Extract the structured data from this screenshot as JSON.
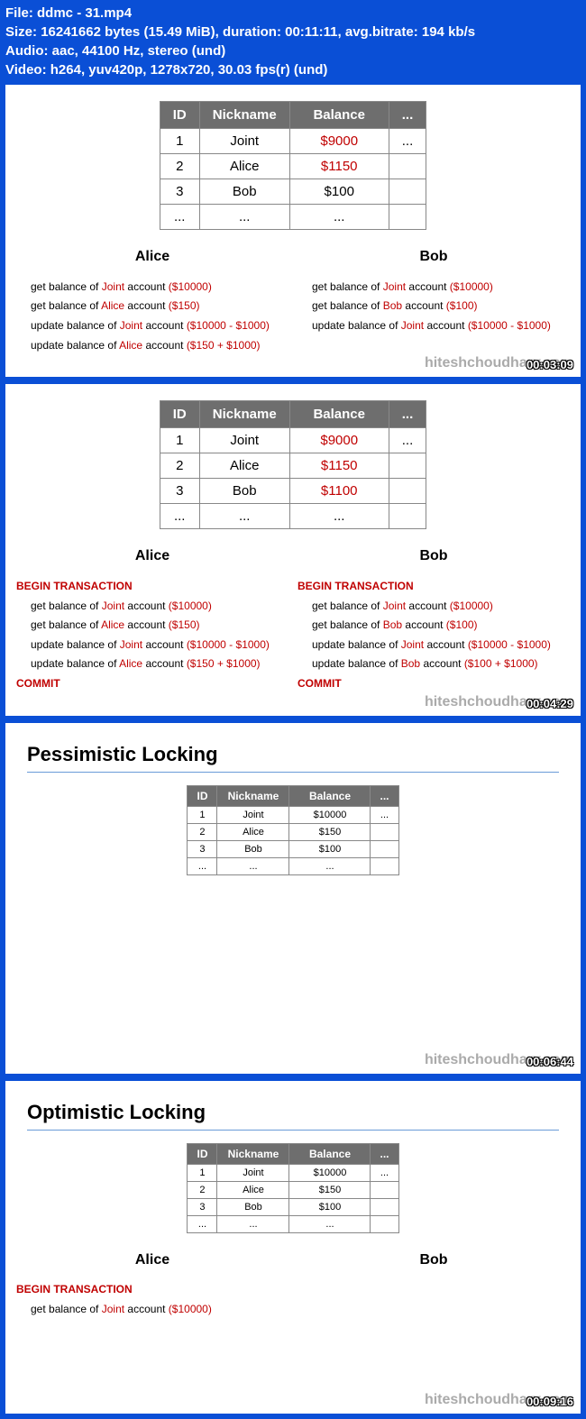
{
  "header": {
    "file_label": "File:",
    "file_value": "ddmc - 31.mp4",
    "size_label": "Size:",
    "size_value": "16241662 bytes (15.49 MiB), duration: 00:11:11, avg.bitrate: 194 kb/s",
    "audio_label": "Audio:",
    "audio_value": "aac, 44100 Hz, stereo (und)",
    "video_label": "Video:",
    "video_value": "h264, yuv420p, 1278x720, 30.03 fps(r) (und)"
  },
  "watermark": "hiteshchoudhary.com",
  "frames": {
    "f1": {
      "timestamp": "00:03:09",
      "table": {
        "headers": [
          "ID",
          "Nickname",
          "Balance",
          "..."
        ],
        "rows": [
          {
            "id": "1",
            "nick": "Joint",
            "bal": "$9000",
            "bal_red": true,
            "dots": "..."
          },
          {
            "id": "2",
            "nick": "Alice",
            "bal": "$1150",
            "bal_red": true,
            "dots": ""
          },
          {
            "id": "3",
            "nick": "Bob",
            "bal": "$100",
            "bal_red": false,
            "dots": ""
          },
          {
            "id": "...",
            "nick": "...",
            "bal": "...",
            "bal_red": false,
            "dots": ""
          }
        ]
      },
      "alice_title": "Alice",
      "bob_title": "Bob",
      "alice_lines": [
        {
          "pre": "get balance of ",
          "red": "Joint",
          "mid": " account ",
          "paren": "($10000)"
        },
        {
          "pre": "get balance of ",
          "red": "Alice",
          "mid": " account ",
          "paren": "($150)"
        },
        {
          "pre": "update balance of ",
          "red": "Joint",
          "mid": " account ",
          "paren": "($10000 - $1000)"
        },
        {
          "pre": "update balance of ",
          "red": "Alice",
          "mid": " account ",
          "paren": "($150 + $1000)"
        }
      ],
      "bob_lines": [
        {
          "pre": "get balance of ",
          "red": "Joint",
          "mid": " account ",
          "paren": "($10000)"
        },
        {
          "pre": "get balance of ",
          "red": "Bob",
          "mid": " account ",
          "paren": "($100)"
        },
        {
          "pre": "update balance of ",
          "red": "Joint",
          "mid": " account ",
          "paren": "($10000 - $1000)"
        }
      ]
    },
    "f2": {
      "timestamp": "00:04:29",
      "table": {
        "headers": [
          "ID",
          "Nickname",
          "Balance",
          "..."
        ],
        "rows": [
          {
            "id": "1",
            "nick": "Joint",
            "bal": "$9000",
            "bal_red": true,
            "dots": "..."
          },
          {
            "id": "2",
            "nick": "Alice",
            "bal": "$1150",
            "bal_red": true,
            "dots": ""
          },
          {
            "id": "3",
            "nick": "Bob",
            "bal": "$1100",
            "bal_red": true,
            "dots": ""
          },
          {
            "id": "...",
            "nick": "...",
            "bal": "...",
            "bal_red": false,
            "dots": ""
          }
        ]
      },
      "begin": "BEGIN TRANSACTION",
      "commit": "COMMIT",
      "alice_title": "Alice",
      "bob_title": "Bob",
      "alice_lines": [
        {
          "pre": "get balance of ",
          "red": "Joint",
          "mid": " account ",
          "paren": "($10000)"
        },
        {
          "pre": "get balance of ",
          "red": "Alice",
          "mid": " account ",
          "paren": "($150)"
        },
        {
          "pre": "update balance of ",
          "red": "Joint",
          "mid": " account ",
          "paren": "($10000 - $1000)"
        },
        {
          "pre": "update balance of ",
          "red": "Alice",
          "mid": " account ",
          "paren": "($150 + $1000)"
        }
      ],
      "bob_lines": [
        {
          "pre": "get balance of ",
          "red": "Joint",
          "mid": " account ",
          "paren": "($10000)"
        },
        {
          "pre": "get balance of ",
          "red": "Bob",
          "mid": " account ",
          "paren": "($100)"
        },
        {
          "pre": "update balance of ",
          "red": "Joint",
          "mid": " account ",
          "paren": "($10000 - $1000)"
        },
        {
          "pre": "update balance of ",
          "red": "Bob",
          "mid": " account ",
          "paren": "($100 + $1000)"
        }
      ]
    },
    "f3": {
      "timestamp": "00:06:44",
      "title": "Pessimistic Locking",
      "table": {
        "headers": [
          "ID",
          "Nickname",
          "Balance",
          "..."
        ],
        "rows": [
          {
            "id": "1",
            "nick": "Joint",
            "bal": "$10000",
            "dots": "..."
          },
          {
            "id": "2",
            "nick": "Alice",
            "bal": "$150",
            "dots": ""
          },
          {
            "id": "3",
            "nick": "Bob",
            "bal": "$100",
            "dots": ""
          },
          {
            "id": "...",
            "nick": "...",
            "bal": "...",
            "dots": ""
          }
        ]
      }
    },
    "f4": {
      "timestamp": "00:09:16",
      "title": "Optimistic Locking",
      "table": {
        "headers": [
          "ID",
          "Nickname",
          "Balance",
          "..."
        ],
        "rows": [
          {
            "id": "1",
            "nick": "Joint",
            "bal": "$10000",
            "dots": "..."
          },
          {
            "id": "2",
            "nick": "Alice",
            "bal": "$150",
            "dots": ""
          },
          {
            "id": "3",
            "nick": "Bob",
            "bal": "$100",
            "dots": ""
          },
          {
            "id": "...",
            "nick": "...",
            "bal": "...",
            "dots": ""
          }
        ]
      },
      "alice_title": "Alice",
      "bob_title": "Bob",
      "begin": "BEGIN TRANSACTION",
      "line": {
        "pre": "get balance of ",
        "red": "Joint",
        "mid": " account ",
        "paren": "($10000)"
      }
    }
  }
}
